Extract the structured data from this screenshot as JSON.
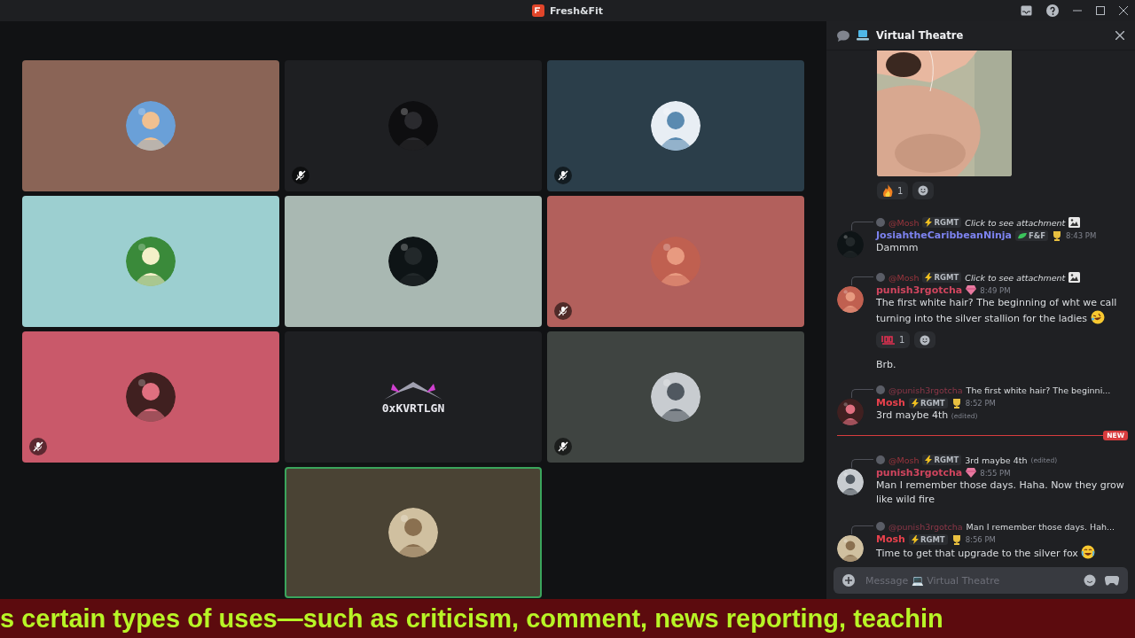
{
  "window": {
    "title": "Fresh&Fit"
  },
  "tiles": [
    {
      "kind": "avatar",
      "color": "#8a6456",
      "muted": false,
      "speaking": false
    },
    {
      "kind": "avatar",
      "color": "#1e1f22",
      "muted": true,
      "speaking": false
    },
    {
      "kind": "avatar",
      "color": "#2b3e4a",
      "muted": true,
      "speaking": false
    },
    {
      "kind": "avatar",
      "color": "#9ccfd0",
      "muted": false,
      "speaking": false
    },
    {
      "kind": "avatar",
      "color": "#a9b8b2",
      "muted": false,
      "speaking": false
    },
    {
      "kind": "avatar",
      "color": "#b2605c",
      "muted": true,
      "speaking": false
    },
    {
      "kind": "avatar",
      "color": "#c9596a",
      "muted": true,
      "speaking": false
    },
    {
      "kind": "logo",
      "color": "#1e1f22",
      "muted": false,
      "speaking": false,
      "label": "0xKVRTLGN"
    },
    {
      "kind": "avatar",
      "color": "#3f4441",
      "muted": true,
      "speaking": false
    },
    {
      "kind": "avatar",
      "color": "#4a4334",
      "muted": false,
      "speaking": true
    }
  ],
  "chat": {
    "title": "Virtual Theatre",
    "items": [
      {
        "kind": "attachment",
        "reactions": [
          {
            "kind": "fire",
            "count": "1"
          }
        ]
      },
      {
        "kind": "message",
        "reply": {
          "mention": "@Mosh",
          "tag": "RGMT",
          "text": "Click to see attachment",
          "kind": "attachment"
        },
        "author": "JosiahtheCaribbeanNinja",
        "color": "#7d83f0",
        "tag": {
          "label": "F&F",
          "kind": "leaf"
        },
        "badge": {
          "kind": "trophy"
        },
        "time": "8:43 PM",
        "text": "Dammm"
      },
      {
        "kind": "message",
        "reply": {
          "mention": "@Mosh",
          "tag": "RGMT",
          "text": "Click to see attachment",
          "kind": "attachment"
        },
        "author": "punish3rgotcha",
        "color": "#d0455e",
        "badge": {
          "kind": "gem"
        },
        "time": "8:49 PM",
        "text": "The first white hair?  The beginning of wht we call turning into the silver stallion for the ladies",
        "emoji": {
          "kind": "rofl"
        },
        "reactions": [
          {
            "kind": "hundred",
            "count": "1"
          }
        ],
        "continuation": "Brb."
      },
      {
        "kind": "message",
        "reply": {
          "mention": "@punish3rgotcha",
          "text": "The first white hair?  The beginni...",
          "kind": "quote"
        },
        "author": "Mosh",
        "color": "#e8414c",
        "tag": {
          "label": "RGMT",
          "kind": "lightning"
        },
        "badge": {
          "kind": "trophy"
        },
        "time": "8:52 PM",
        "text": "3rd maybe 4th",
        "edited": "(edited)"
      },
      {
        "kind": "divider",
        "label": "NEW"
      },
      {
        "kind": "message",
        "reply": {
          "mention": "@Mosh",
          "tag": "RGMT",
          "text": "3rd maybe 4th",
          "edited": "(edited)",
          "kind": "quote"
        },
        "author": "punish3rgotcha",
        "color": "#d0455e",
        "badge": {
          "kind": "gem"
        },
        "time": "8:55 PM",
        "text": "Man I remember those days. Haha. Now they grow like wild fire"
      },
      {
        "kind": "message",
        "reply": {
          "mention": "@punish3rgotcha",
          "text": "Man I remember those days. Hah...",
          "kind": "quote"
        },
        "author": "Mosh",
        "color": "#e8414c",
        "tag": {
          "label": "RGMT",
          "kind": "lightning"
        },
        "badge": {
          "kind": "trophy"
        },
        "time": "8:56 PM",
        "text": "Time to get that upgrade to the silver fox",
        "emoji": {
          "kind": "joy"
        }
      }
    ],
    "input": {
      "placeholder": "Message 💻 Virtual Theatre"
    }
  },
  "banner": {
    "text": "s certain types of uses—such as criticism, comment, news reporting, teachin"
  }
}
